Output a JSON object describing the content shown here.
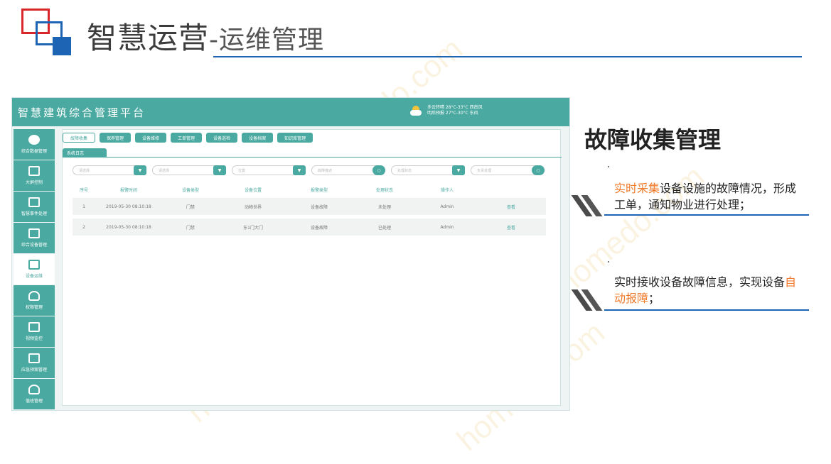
{
  "slide": {
    "title_main": "智慧运营",
    "title_sub": "-运维管理"
  },
  "app": {
    "title": "智慧建筑综合管理平台",
    "weather": {
      "line1": "多云转晴   28°C-33°C   西南风",
      "line2": "明后预报   27°C-30°C   东风",
      "icon": "weather-cloud-sun-icon"
    },
    "sidebar": [
      {
        "label": "综合数据管理",
        "icon": "pie-chart-icon"
      },
      {
        "label": "大屏控制",
        "icon": "monitor-icon"
      },
      {
        "label": "智慧事件处理",
        "icon": "document-edit-icon"
      },
      {
        "label": "综合设备管理",
        "icon": "network-icon"
      },
      {
        "label": "设备运维",
        "icon": "checklist-icon"
      },
      {
        "label": "权限管理",
        "icon": "user-key-icon"
      },
      {
        "label": "视频监控",
        "icon": "camera-screen-icon"
      },
      {
        "label": "应急预案管理",
        "icon": "edit-plan-icon"
      },
      {
        "label": "值班管理",
        "icon": "user-clock-icon"
      }
    ],
    "tabs": [
      "故障收集",
      "保养管理",
      "设备维修",
      "工单管理",
      "设备巡检",
      "设备档案",
      "知识库管理"
    ],
    "sub_tab": "系统日志",
    "filters": [
      {
        "placeholder": "请选择",
        "button": "▼"
      },
      {
        "placeholder": "请选择",
        "button": "▼"
      },
      {
        "placeholder": "位置",
        "button": "▼"
      },
      {
        "placeholder": "故障描述",
        "button": "○"
      },
      {
        "placeholder": "处理状态",
        "button": "▼"
      },
      {
        "placeholder": "负责处理",
        "button": "○"
      }
    ],
    "table": {
      "headers": [
        "序号",
        "报警时间",
        "设备类型",
        "设备位置",
        "报警类型",
        "处理状态",
        "操作人",
        ""
      ],
      "rows": [
        [
          "1",
          "2019-05-30 08:10:18",
          "门禁",
          "动物世界",
          "设备故障",
          "未处理",
          "Admin",
          "查看"
        ],
        [
          "2",
          "2019-05-30 08:10:18",
          "门禁",
          "东1门大门",
          "设备故障",
          "已处理",
          "Admin",
          "查看"
        ]
      ]
    }
  },
  "panel": {
    "title": "故障收集管理",
    "bullet1": {
      "highlight": "实时采集",
      "text": "设备设施的故障情况，形成工单，通知物业进行处理；"
    },
    "bullet2": {
      "text_before": "实时接收设备故障信息，实现设备",
      "highlight": "自动报障",
      "text_after": "；"
    }
  },
  "colors": {
    "accent": "#4aa9a0",
    "brand_blue": "#1e64b4",
    "highlight": "#f07a2a"
  }
}
